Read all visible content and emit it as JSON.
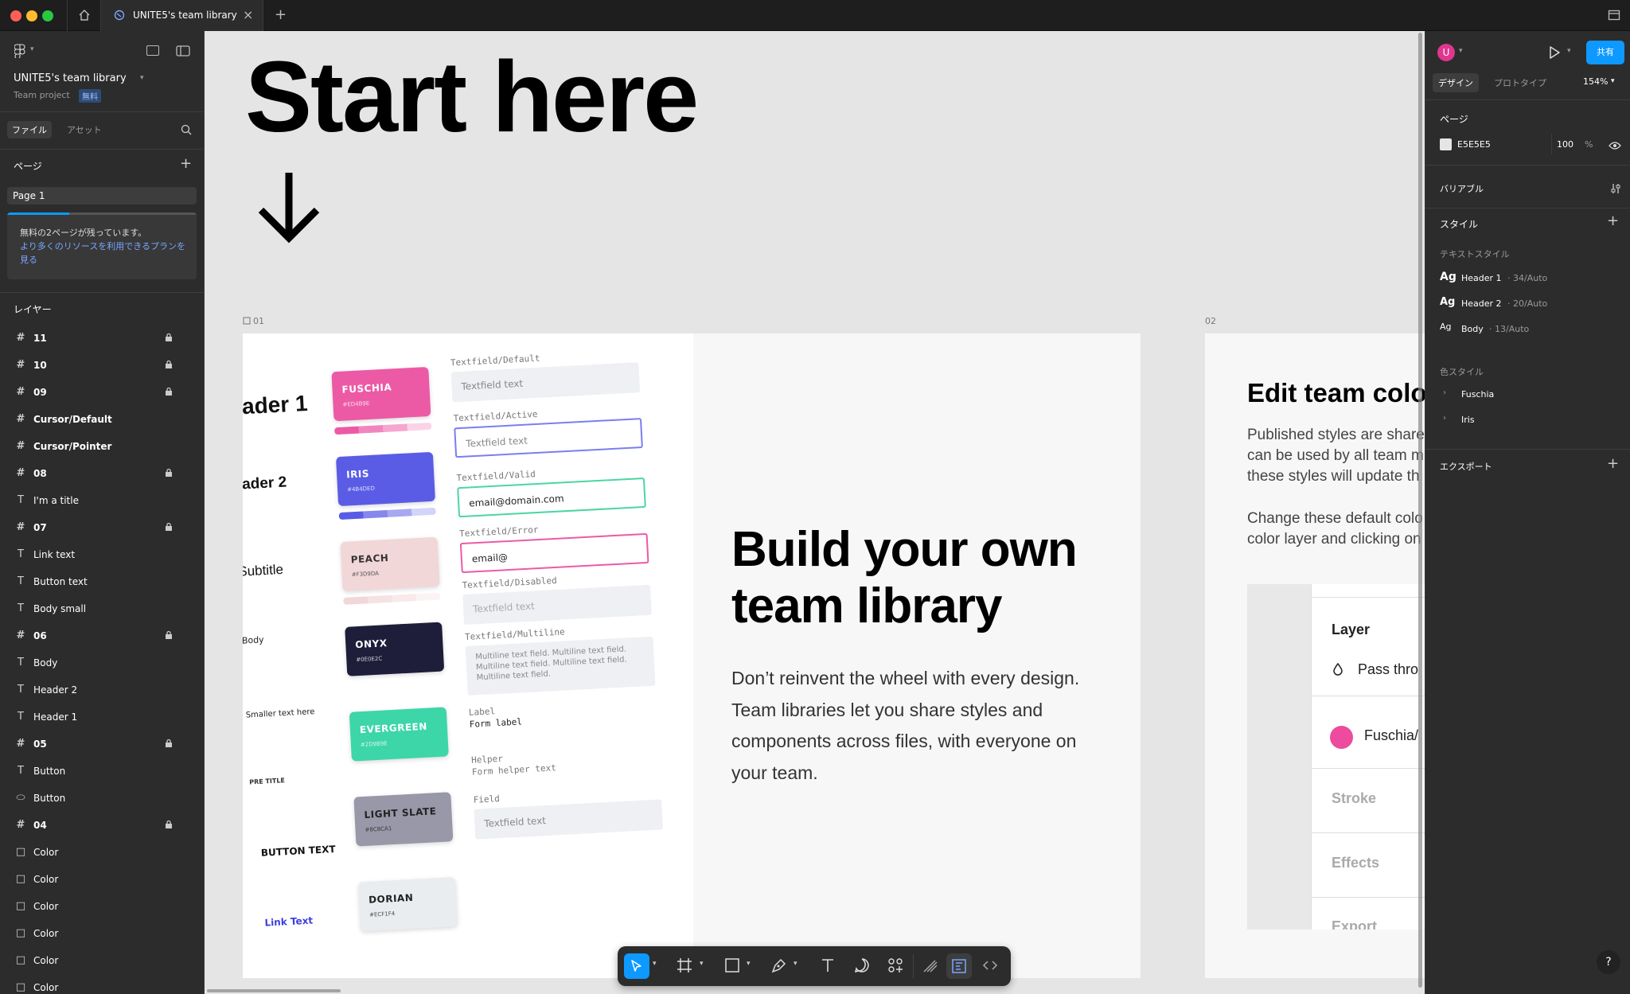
{
  "window": {
    "tab_title": "UNITE5's team library"
  },
  "left": {
    "file_name": "UNITE5's team library",
    "project": "Team project",
    "plan_badge": "無料",
    "tabs": [
      "ファイル",
      "アセット"
    ],
    "pages_label": "ページ",
    "current_page": "Page 1",
    "notice_line1": "無料の2ページが残っています。",
    "notice_link": "より多くのリソースを利用できるプランを見る",
    "layers_label": "レイヤー",
    "layers": [
      {
        "name": "11",
        "icon": "frame-icon",
        "locked": true
      },
      {
        "name": "10",
        "icon": "frame-icon",
        "locked": true
      },
      {
        "name": "09",
        "icon": "frame-icon",
        "locked": true
      },
      {
        "name": "Cursor/Default",
        "icon": "frame-icon",
        "locked": false
      },
      {
        "name": "Cursor/Pointer",
        "icon": "frame-icon",
        "locked": false
      },
      {
        "name": "08",
        "icon": "frame-icon",
        "locked": true
      },
      {
        "name": "I'm a title",
        "icon": "text-icon",
        "locked": false
      },
      {
        "name": "07",
        "icon": "frame-icon",
        "locked": true
      },
      {
        "name": "Link text",
        "icon": "text-icon",
        "locked": false
      },
      {
        "name": "Button text",
        "icon": "text-icon",
        "locked": false
      },
      {
        "name": "Body small",
        "icon": "text-icon",
        "locked": false
      },
      {
        "name": "06",
        "icon": "frame-icon",
        "locked": true
      },
      {
        "name": "Body",
        "icon": "text-icon",
        "locked": false
      },
      {
        "name": "Header 2",
        "icon": "text-icon",
        "locked": false
      },
      {
        "name": "Header 1",
        "icon": "text-icon",
        "locked": false
      },
      {
        "name": "05",
        "icon": "frame-icon",
        "locked": true
      },
      {
        "name": "Button",
        "icon": "text-icon",
        "locked": false
      },
      {
        "name": "Button",
        "icon": "ellipse-icon",
        "locked": false
      },
      {
        "name": "04",
        "icon": "frame-icon",
        "locked": true
      },
      {
        "name": "Color",
        "icon": "rect-icon",
        "locked": false
      },
      {
        "name": "Color",
        "icon": "rect-icon",
        "locked": false
      },
      {
        "name": "Color",
        "icon": "rect-icon",
        "locked": false
      },
      {
        "name": "Color",
        "icon": "rect-icon",
        "locked": false
      },
      {
        "name": "Color",
        "icon": "rect-icon",
        "locked": false
      },
      {
        "name": "Color",
        "icon": "rect-icon",
        "locked": false
      }
    ]
  },
  "canvas": {
    "start_here": "Start here",
    "arrow": "↓",
    "frame1_label": "01",
    "frame2_label": "02",
    "type_samples": [
      "eader 1",
      "eader 2",
      "Subtitle",
      "Body",
      "Smaller text here",
      "PRE TITLE",
      "BUTTON TEXT",
      "Link Text"
    ],
    "swatches": [
      {
        "name": "FUSCHIA",
        "hex": "#ED4B9E",
        "color": "#ec5aa6",
        "text": "#fff"
      },
      {
        "name": "IRIS",
        "hex": "#4B4DED",
        "color": "#5a5ce6",
        "text": "#fff"
      },
      {
        "name": "PEACH",
        "hex": "#F3D9DA",
        "color": "#f1d7d8",
        "text": "#333"
      },
      {
        "name": "ONYX",
        "hex": "#0E0E2C",
        "color": "#1e1e3a",
        "text": "#fff"
      },
      {
        "name": "EVERGREEN",
        "hex": "#2D9B9E",
        "color": "#3dd6a8",
        "text": "#fff"
      },
      {
        "name": "LIGHT SLATE",
        "hex": "#8C8CA1",
        "color": "#9898a8",
        "text": "#222"
      },
      {
        "name": "DORIAN",
        "hex": "#ECF1F4",
        "color": "#e9edf0",
        "text": "#222"
      }
    ],
    "textfields": [
      {
        "label": "Textfield/Default",
        "value": "Textfield text"
      },
      {
        "label": "Textfield/Active",
        "value": "Textfield text"
      },
      {
        "label": "Textfield/Valid",
        "value": "email@domain.com"
      },
      {
        "label": "Textfield/Error",
        "value": "email@"
      },
      {
        "label": "Textfield/Disabled",
        "value": "Textfield text"
      },
      {
        "label": "Textfield/Multiline",
        "value": "Multiline text field. Multiline text field. Multiline text field. Multiline text field. Multiline text field."
      }
    ],
    "form": {
      "label_cap": "Label",
      "label_val": "Form label",
      "helper_cap": "Helper",
      "helper_val": "Form helper text",
      "field_cap": "Field",
      "field_val": "Textfield text"
    },
    "build_heading": "Build your own team library",
    "build_body": "Don’t reinvent the wheel with every design. Team libraries let you share styles and components across files, with everyone on your team.",
    "edit_heading": "Edit team colo",
    "edit_body1": "Published styles are share can be used by all team m these styles will update th",
    "edit_body2": "Change these default colo color layer and clicking on",
    "panel": {
      "layer": "Layer",
      "pass": "Pass thro",
      "fill": "Fuschia/",
      "stroke": "Stroke",
      "effects": "Effects",
      "export": "Export"
    }
  },
  "right": {
    "avatar": "U",
    "share": "共有",
    "tabs": [
      "デザイン",
      "プロトタイプ"
    ],
    "zoom": "154%",
    "page_label": "ページ",
    "bg_hex": "E5E5E5",
    "bg_opacity": "100",
    "percent": "%",
    "variables": "バリアブル",
    "styles": "スタイル",
    "text_styles": "テキストスタイル",
    "text_style_items": [
      {
        "ag": "Ag",
        "name": "Header 1",
        "meta": " · 34/Auto"
      },
      {
        "ag": "Ag",
        "name": "Header 2",
        "meta": " · 20/Auto"
      },
      {
        "ag": "Ag",
        "name": "Body",
        "meta": " · 13/Auto"
      }
    ],
    "color_styles": "色スタイル",
    "color_items": [
      "Fuschia",
      "Iris"
    ],
    "export": "エクスポート",
    "help": "?"
  }
}
